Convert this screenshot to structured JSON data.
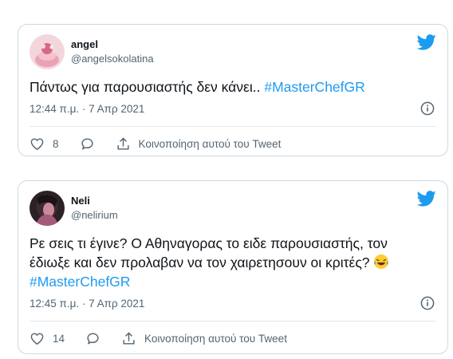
{
  "colors": {
    "accent": "#1d9bf0",
    "text": "#0f1419",
    "secondary": "#536471",
    "border": "#cfd9de"
  },
  "tweets": [
    {
      "display_name": "angel",
      "handle": "@angelsokolatina",
      "text": "Πάντως για παρουσιαστής δεν κάνει.. ",
      "hashtag": "#MasterChefGR",
      "timestamp": "12:44 π.μ. · 7 Απρ 2021",
      "like_count": "8",
      "share_label": "Κοινοποίηση αυτού του Tweet",
      "icons": [
        "twitter-bird-icon",
        "info-icon",
        "heart-icon",
        "reply-icon",
        "share-icon"
      ]
    },
    {
      "display_name": "Neli",
      "handle": "@nelirium",
      "text_line1": "Ρε σεις τι έγινε? Ο Αθηναγορας το ειδε παρουσιαστής, τον",
      "text_line2": "έδιωξε και δεν προλαβαν να τον χαιρετησουν οι κριτές?",
      "hashtag": "#MasterChefGR",
      "timestamp": "12:45 π.μ. · 7 Απρ 2021",
      "like_count": "14",
      "share_label": "Κοινοποίηση αυτού του Tweet",
      "icons": [
        "twitter-bird-icon",
        "info-icon",
        "heart-icon",
        "reply-icon",
        "share-icon",
        "laughing-tears-emoji-icon"
      ]
    }
  ]
}
